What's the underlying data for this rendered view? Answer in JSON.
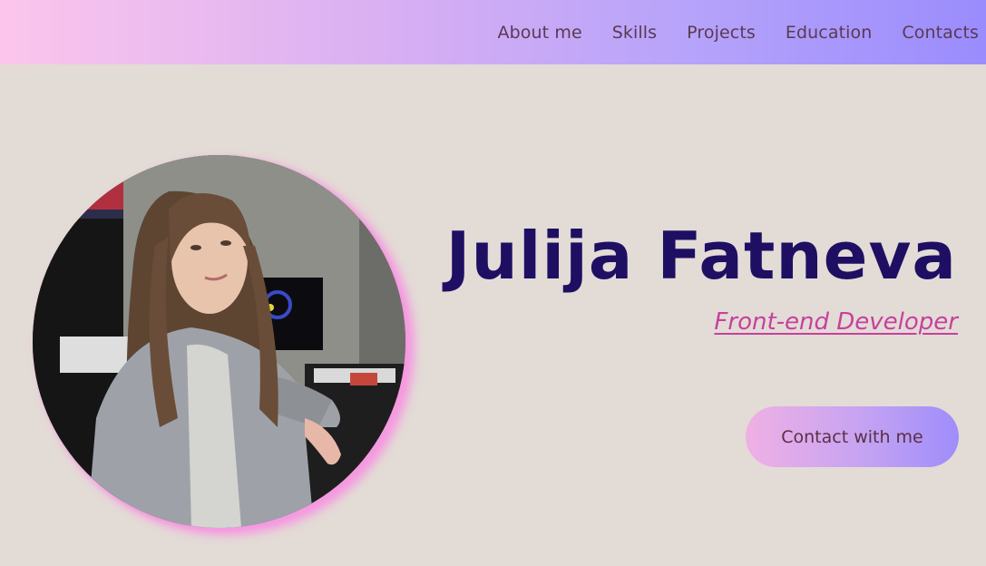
{
  "nav": {
    "items": [
      {
        "label": "About me"
      },
      {
        "label": "Skills"
      },
      {
        "label": "Projects"
      },
      {
        "label": "Education"
      },
      {
        "label": "Contacts"
      }
    ]
  },
  "hero": {
    "name": "Julija Fatneva",
    "role": "Front-end Developer",
    "cta_label": "Contact with me"
  },
  "colors": {
    "background": "#e3dbd6",
    "name_color": "#1e0f63",
    "role_color": "#c7409e",
    "photo_glow": "#f59ae0"
  }
}
